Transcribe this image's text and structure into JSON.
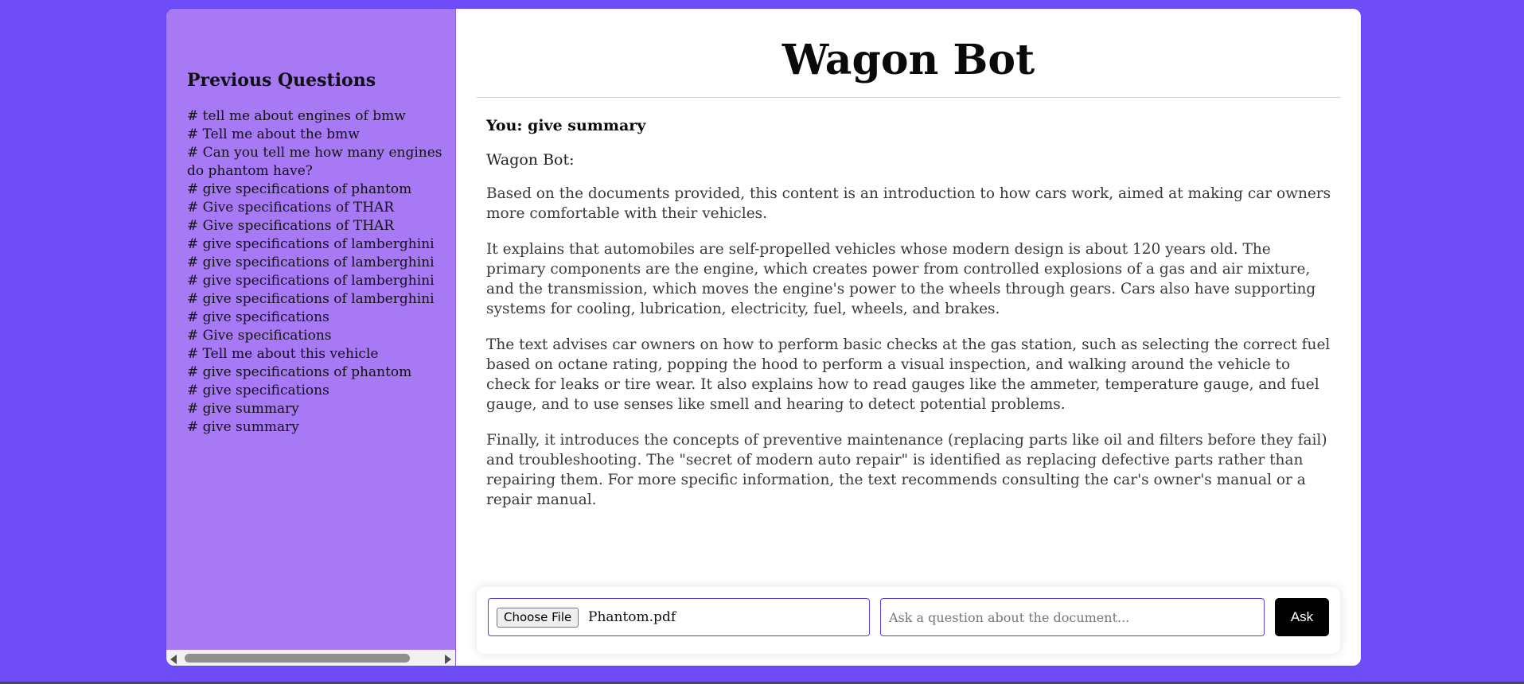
{
  "sidebar": {
    "title": "Previous Questions",
    "items": [
      "# tell me about engines of bmw",
      "# Tell me about the bmw",
      "# Can you tell me how many engines do phantom have?",
      "# give specifications of phantom",
      "# Give specifications of THAR",
      "# Give specifications of THAR",
      "# give specifications of lamberghini",
      "# give specifications of lamberghini",
      "# give specifications of lamberghini",
      "# give specifications of lamberghini",
      "# give specifications",
      "# Give specifications",
      "# Tell me about this vehicle",
      "# give specifications of phantom",
      "# give specifications",
      "# give summary",
      "# give summary"
    ]
  },
  "main": {
    "title": "Wagon Bot",
    "chat": {
      "you": "You: give summary",
      "bot_label": "Wagon Bot:",
      "paragraphs": [
        "Based on the documents provided, this content is an introduction to how cars work, aimed at making car owners more comfortable with their vehicles.",
        "It explains that automobiles are self-propelled vehicles whose modern design is about 120 years old. The primary components are the engine, which creates power from controlled explosions of a gas and air mixture, and the transmission, which moves the engine's power to the wheels through gears. Cars also have supporting systems for cooling, lubrication, electricity, fuel, wheels, and brakes.",
        "The text advises car owners on how to perform basic checks at the gas station, such as selecting the correct fuel based on octane rating, popping the hood to perform a visual inspection, and walking around the vehicle to check for leaks or tire wear. It also explains how to read gauges like the ammeter, temperature gauge, and fuel gauge, and to use senses like smell and hearing to detect potential problems.",
        "Finally, it introduces the concepts of preventive maintenance (replacing parts like oil and filters before they fail) and troubleshooting. The \"secret of modern auto repair\" is identified as replacing defective parts rather than repairing them. For more specific information, the text recommends consulting the car's owner's manual or a repair manual."
      ]
    }
  },
  "input_bar": {
    "choose_file_label": "Choose File",
    "file_name": "Phantom.pdf",
    "question_placeholder": "Ask a question about the document...",
    "ask_label": "Ask"
  },
  "colors": {
    "page_background": "#6e4cf8",
    "sidebar_background": "#a879f5",
    "input_border": "#5b3fe0",
    "ask_button": "#000000"
  },
  "icons": {
    "scroll_left": "triangle-left-icon",
    "scroll_right": "triangle-right-icon"
  }
}
